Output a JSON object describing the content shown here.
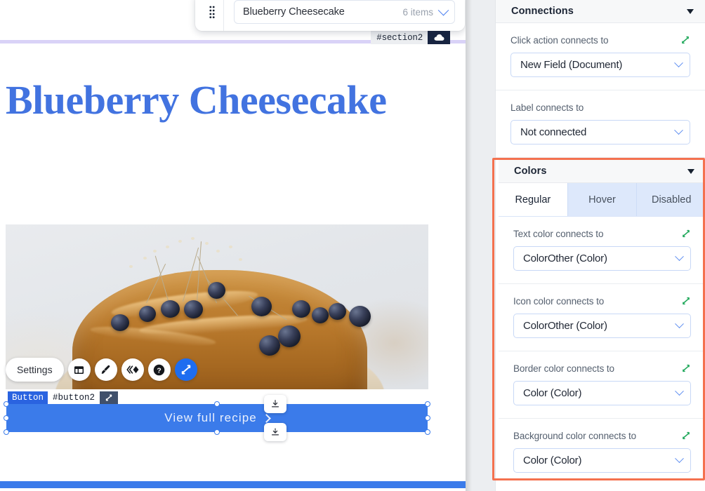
{
  "canvas": {
    "repeater": {
      "drag_handle": "drag-handle",
      "name": "Blueberry Cheesecake",
      "count": "6 items"
    },
    "section_tag": {
      "id": "#section2",
      "icon": "cloud-icon"
    },
    "page_title": "Blueberry Cheesecake",
    "toolbar": {
      "settings_label": "Settings",
      "buttons": [
        {
          "name": "layout-icon"
        },
        {
          "name": "paintbrush-icon"
        },
        {
          "name": "animation-icon"
        },
        {
          "name": "help-icon"
        },
        {
          "name": "connect-icon"
        }
      ]
    },
    "selected_element": {
      "type_badge": "Button",
      "id_badge": "#button2",
      "connect_badge": "connect-icon",
      "label": "View full recipe",
      "arrow": "chevron-right-icon"
    },
    "snap_buttons": [
      {
        "name": "dock-top-icon"
      },
      {
        "name": "dock-bottom-icon"
      }
    ]
  },
  "panel": {
    "connections": {
      "title": "Connections",
      "fields": [
        {
          "label": "Click action connects to",
          "value": "New Field (Document)",
          "connected": true
        },
        {
          "label": "Label connects to",
          "value": "Not connected",
          "connected": false
        }
      ]
    },
    "colors": {
      "title": "Colors",
      "tabs": [
        {
          "label": "Regular",
          "active": true
        },
        {
          "label": "Hover",
          "active": false
        },
        {
          "label": "Disabled",
          "active": false
        }
      ],
      "fields": [
        {
          "label": "Text color connects to",
          "value": "ColorOther (Color)",
          "connected": true
        },
        {
          "label": "Icon color connects to",
          "value": "ColorOther (Color)",
          "connected": true
        },
        {
          "label": "Border color connects to",
          "value": "Color (Color)",
          "connected": true
        },
        {
          "label": "Background color connects to",
          "value": "Color (Color)",
          "connected": true
        }
      ]
    }
  },
  "colors": {
    "accent_blue": "#3b7bea",
    "title_blue": "#4273e0",
    "highlight_orange": "#f4714f",
    "connect_green": "#1fa85a",
    "tab_inactive_bg": "#dde8fb",
    "section_divider": "#d9d2f7"
  }
}
